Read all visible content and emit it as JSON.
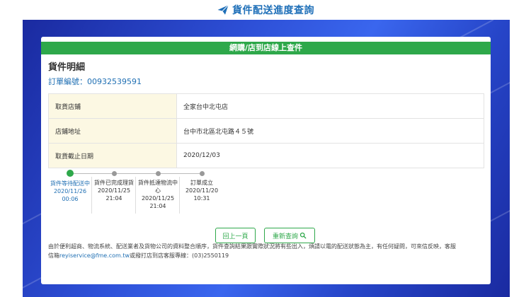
{
  "header": {
    "title": "貨件配送進度查詢",
    "icon": "paper-plane-icon",
    "color": "#1e6fb8"
  },
  "banner": {
    "title": "網購/店到店線上查件",
    "color": "#2ea84a"
  },
  "detail": {
    "title": "貨件明細",
    "order_label": "訂單編號：",
    "order_number": "00932539591"
  },
  "info": [
    {
      "label": "取貨店鋪",
      "value": "全家台中北屯店"
    },
    {
      "label": "店鋪地址",
      "value": "台中市北區北屯路４５號"
    },
    {
      "label": "取貨截止日期",
      "value": "2020/12/03"
    }
  ],
  "tracking": [
    {
      "label": "貨件等待配送中",
      "date": "2020/11/26",
      "time": "00:06",
      "current": true
    },
    {
      "label": "貨件已完成理貨",
      "date": "2020/11/25",
      "time": "21:04",
      "current": false
    },
    {
      "label": "貨件抵達物流中心",
      "date": "2020/11/25",
      "time": "21:04",
      "current": false
    },
    {
      "label": "訂單成立",
      "date": "2020/11/20",
      "time": "10:31",
      "current": false
    }
  ],
  "buttons": {
    "back": "回上一頁",
    "requery": "重新查詢"
  },
  "notice": {
    "line1": "由於便利超商、物流系統、配送業者及貨物公司的資料整合順序，貨件查詢結果跟實際狀況將有些出入，煩請以電的配送狀態為主，有任何疑問，可來信反映，客服",
    "prefix": "信箱",
    "email": "reyiservice@fme.com.tw",
    "suffix": "或撥打店到店客服專線：(03)2550119"
  }
}
